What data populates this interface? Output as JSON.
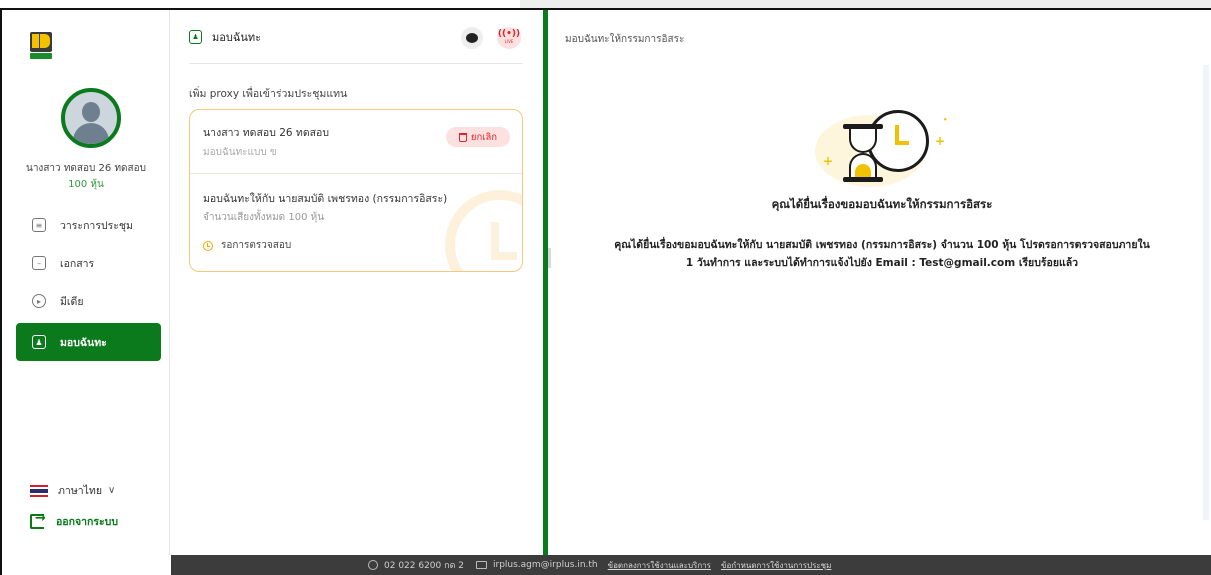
{
  "sidebar": {
    "user": {
      "name": "นางสาว ทดสอบ 26 ทดสอบ",
      "shares": "100 หุ้น"
    },
    "nav": [
      {
        "label": "วาระการประชุม",
        "icon": "agenda-icon"
      },
      {
        "label": "เอกสาร",
        "icon": "document-icon"
      },
      {
        "label": "มีเดีย",
        "icon": "media-icon"
      },
      {
        "label": "มอบฉันทะ",
        "icon": "proxy-icon",
        "active": true
      }
    ],
    "language": "ภาษาไทย",
    "logout": "ออกจากระบบ"
  },
  "middle": {
    "title": "มอบฉันทะ",
    "add_proxy_link": "เพิ่ม proxy เพื่อเข้าร่วมประชุมแทน",
    "card": {
      "name": "นางสาว ทดสอบ 26 ทดสอบ",
      "type": "มอบฉันทะแบบ ข",
      "cancel_label": "ยกเลิก",
      "proxy_to": "มอบฉันทะให้กับ นายสมบัติ เพชรทอง (กรรมการอิสระ)",
      "votes": "จำนวนเสียงทั้งหมด 100 หุ้น",
      "status": "รอการตรวจสอบ"
    }
  },
  "right": {
    "title": "มอบฉันทะให้กรรมการอิสระ",
    "heading": "คุณได้ยื่นเรื่องขอมอบฉันทะให้กรรมการอิสระ",
    "message_line1": "คุณได้ยื่นเรื่องขอมอบฉันทะให้กับ นายสมบัติ เพชรทอง (กรรมการอิสระ) จำนวน 100 หุ้น โปรดรอการตรวจสอบภายใน",
    "message_line2": "1 วันทำการ และระบบได้ทำการแจ้งไปยัง Email : Test@gmail.com เรียบร้อยแล้ว"
  },
  "footer": {
    "phone": "02 022 6200 กด 2",
    "email": "irplus.agm@irplus.in.th",
    "link_terms": "ข้อตกลงการใช้งานและบริการ",
    "link_rules": "ข้อกำหนดการใช้งานการประชุม"
  },
  "colors": {
    "brand_green": "#0a7a1c",
    "accent_yellow": "#f2c200",
    "danger_red": "#e0242c",
    "card_border": "#f4c97a"
  }
}
